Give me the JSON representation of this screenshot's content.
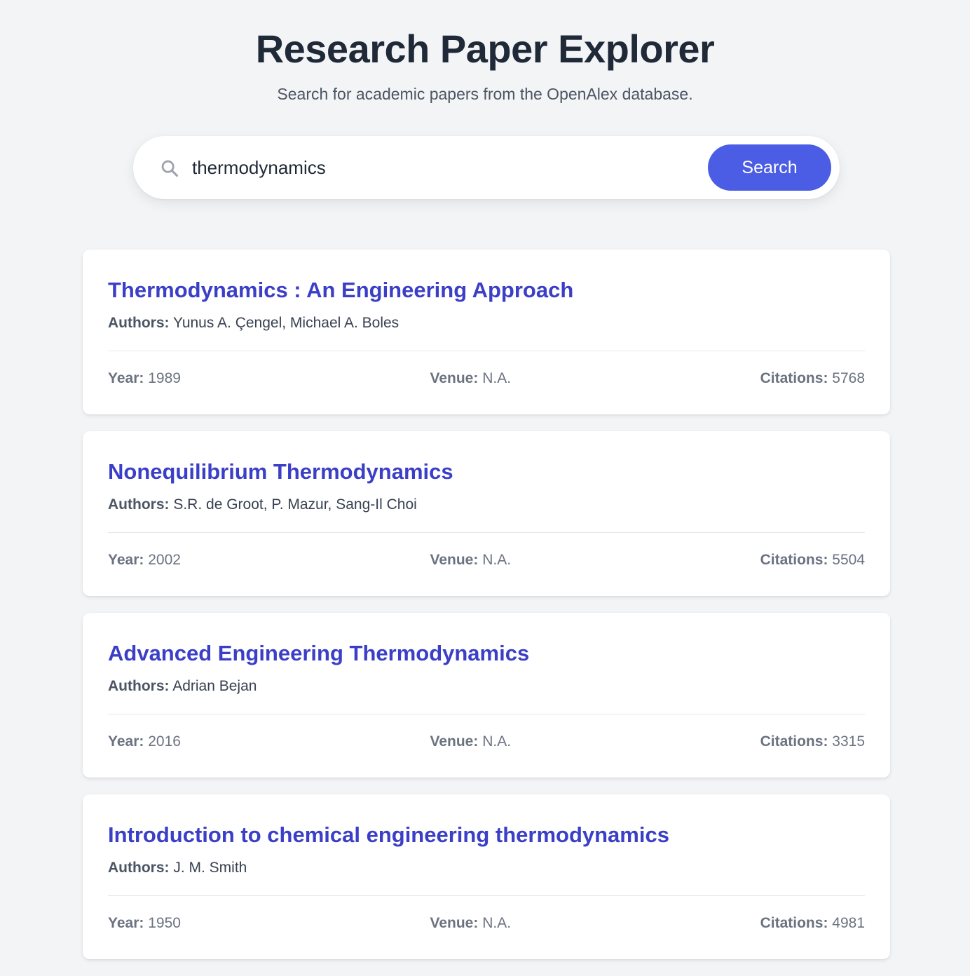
{
  "header": {
    "title": "Research Paper Explorer",
    "subtitle": "Search for academic papers from the OpenAlex database."
  },
  "search": {
    "icon": "search-icon",
    "value": "thermodynamics",
    "button_label": "Search"
  },
  "labels": {
    "authors": "Authors:",
    "year": "Year:",
    "venue": "Venue:",
    "citations": "Citations:"
  },
  "results": [
    {
      "title": "Thermodynamics : An Engineering Approach",
      "authors": "Yunus A. Çengel, Michael A. Boles",
      "year": "1989",
      "venue": "N.A.",
      "citations": "5768"
    },
    {
      "title": "Nonequilibrium Thermodynamics",
      "authors": "S.R. de Groot, P. Mazur, Sang-Il Choi",
      "year": "2002",
      "venue": "N.A.",
      "citations": "5504"
    },
    {
      "title": "Advanced Engineering Thermodynamics",
      "authors": "Adrian Bejan",
      "year": "2016",
      "venue": "N.A.",
      "citations": "3315"
    },
    {
      "title": "Introduction to chemical engineering thermodynamics",
      "authors": "J. M. Smith",
      "year": "1950",
      "venue": "N.A.",
      "citations": "4981"
    }
  ],
  "colors": {
    "background": "#f3f4f6",
    "accent": "#4a5de4",
    "title_link": "#3b3fc7"
  }
}
